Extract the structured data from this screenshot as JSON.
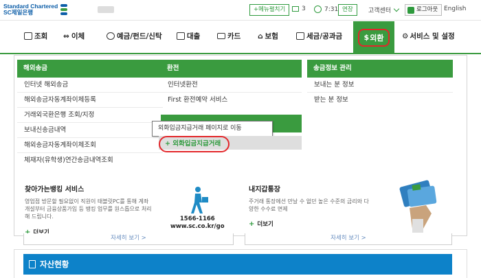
{
  "header": {
    "logo_en": "Standard Chartered",
    "logo_kr": "SC제일은행",
    "menu_toggle": "+메뉴펼치기",
    "mail_count": "3",
    "timer": "7:31",
    "extend": "연장",
    "customer_center": "고객센터",
    "logout": "로그아웃",
    "english": "English"
  },
  "nav": {
    "items": [
      "조회",
      "이체",
      "예금/펀드/신탁",
      "대출",
      "카드",
      "보험",
      "세금/공과금"
    ],
    "active": "외환",
    "last": "서비스 및 설정"
  },
  "menu": {
    "col1": {
      "title": "해외송금",
      "items": [
        "인터넷 해외송금",
        "해외송금자동계좌이체등록",
        "거래외국환은행 조회/지정",
        "보내신송금내역",
        "해외송금자동계좌이체조회",
        "체재자(유학생)연간송금내역조회"
      ]
    },
    "col2": {
      "title": "환전",
      "items": [
        "인터넷환전",
        "First 환전예약 서비스"
      ]
    },
    "col3": {
      "title": "송금정보 관리",
      "items": [
        "보내는 분 정보",
        "받는 분 정보"
      ]
    },
    "tooltip": "외화입금지급거래 페이지로 이동",
    "highlighted": "+ 외화입금지급거래"
  },
  "promos": {
    "left": {
      "title": "찾아가는뱅킹 서비스",
      "desc": "영업점 방문할 필요없이 직원이 태블릿PC를 통해 계좌 개설부터 금융상품가입 등 뱅킹 업무를 원스톱으로 처리해 드립니다.",
      "more": "더보기",
      "phone": "1566-1166",
      "url": "www.sc.co.kr/go"
    },
    "right": {
      "title": "내지갑통장",
      "desc": "주거래 통장에선 만날 수 없던 높은 수준의 금리와 다양한 수수료 면제",
      "more": "더보기"
    }
  },
  "behind": {
    "more_left": "자세히 보기 >",
    "more_right": "자세히 보기 >",
    "assets": "자산현황"
  }
}
